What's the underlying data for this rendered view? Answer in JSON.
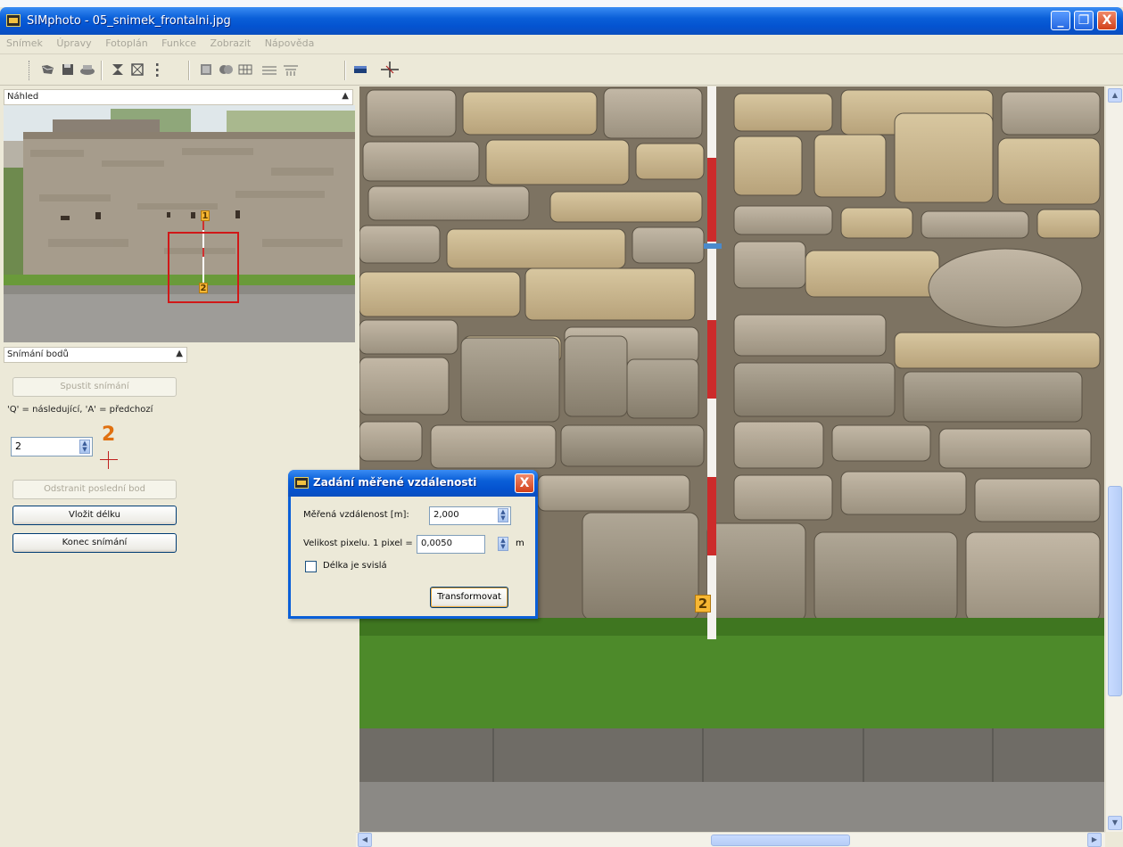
{
  "window": {
    "title": "SIMphoto - 05_snimek_frontalni.jpg",
    "controls": [
      "_",
      "❐",
      "X"
    ]
  },
  "menu": [
    "Snímek",
    "Úpravy",
    "Fotoplán",
    "Funkce",
    "Zobrazit",
    "Nápověda"
  ],
  "toolbar": {
    "icons": [
      "open-icon",
      "save-icon",
      "print-icon",
      "fit-icon",
      "crop-icon",
      "more-icon",
      "layers-icon",
      "merge-icon",
      "grid-icon",
      "lines-icon",
      "measure-icon",
      "color-icon",
      "crosshair-icon"
    ]
  },
  "preview_panel": {
    "title": "Náhled",
    "point_labels": [
      "1",
      "2"
    ]
  },
  "capture_panel": {
    "title": "Snímání bodů",
    "start_button": "Spustit snímání",
    "hint": "'Q' = následující, 'A' = předchozí",
    "point_number_value": "2",
    "current_point_label": "2",
    "remove_last_button": "Odstranit poslední bod",
    "insert_length_button": "Vložit délku",
    "end_button": "Konec snímání"
  },
  "main_view": {
    "point_label": "2"
  },
  "dialog": {
    "title": "Zadání měřené vzdálenosti",
    "close": "X",
    "measured_distance_label": "Měřená vzdálenost [m]:",
    "measured_distance_value": "2,000",
    "pixel_size_label": "Velikost pixelu. 1 pixel =",
    "pixel_size_value": "0,0050",
    "pixel_size_unit": "m",
    "vertical_checkbox_label": "Délka je svislá",
    "vertical_checked": false,
    "transform_button": "Transformovat"
  },
  "colors": {
    "titlebar": "#0a5fd8",
    "point_marker": "#f7b733",
    "selection_rect": "#d01818",
    "bignum": "#e07010"
  }
}
